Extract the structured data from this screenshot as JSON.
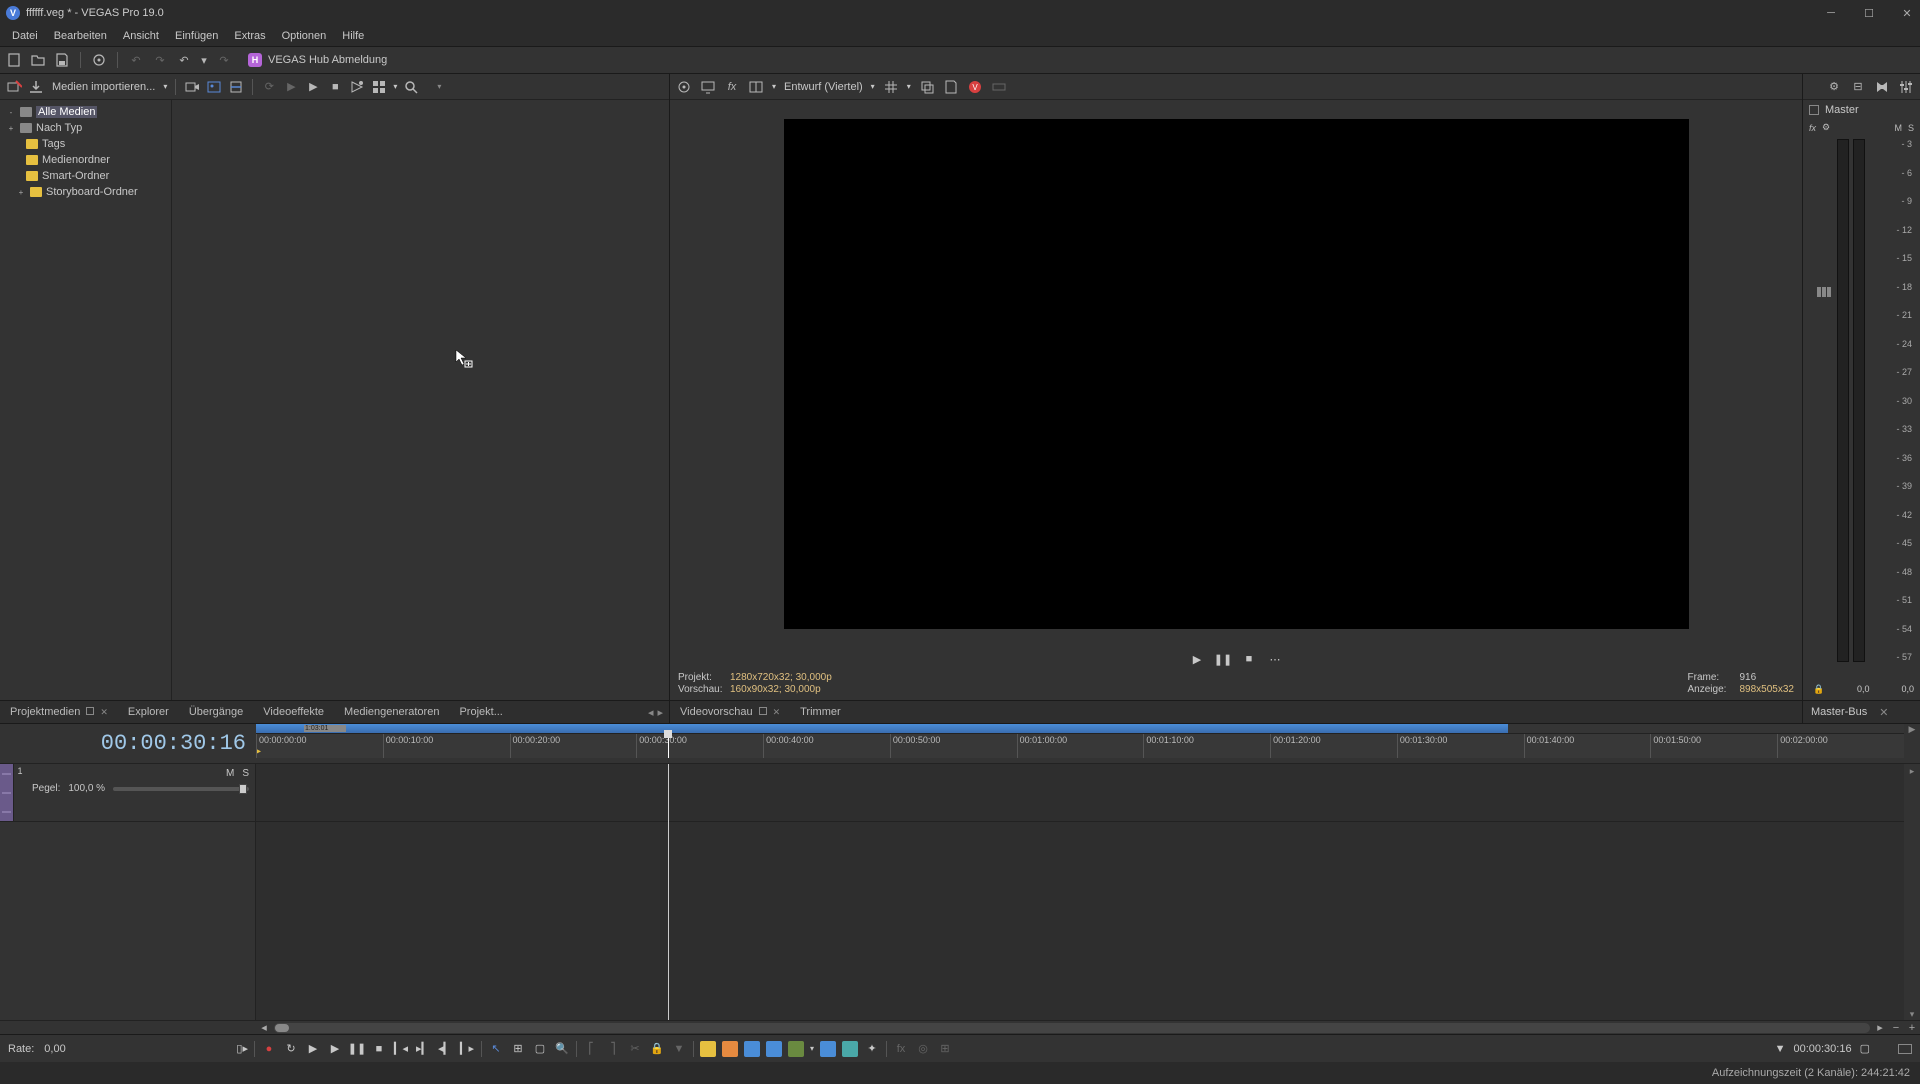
{
  "title": "ffffff.veg * - VEGAS Pro 19.0",
  "logo": "V",
  "menu": [
    "Datei",
    "Bearbeiten",
    "Ansicht",
    "Einfügen",
    "Extras",
    "Optionen",
    "Hilfe"
  ],
  "hub": {
    "icon": "H",
    "label": "VEGAS Hub Abmeldung"
  },
  "leftToolbar": {
    "import": "Medien importieren..."
  },
  "tree": [
    {
      "label": "Alle Medien",
      "sel": true,
      "exp": "-",
      "root": true,
      "indent": false
    },
    {
      "label": "Nach Typ",
      "exp": "+",
      "root": true,
      "indent": false
    },
    {
      "label": "Tags",
      "indent": true
    },
    {
      "label": "Medienordner",
      "indent": true
    },
    {
      "label": "Smart-Ordner",
      "indent": true
    },
    {
      "label": "Storyboard-Ordner",
      "exp": "+",
      "indent": true
    }
  ],
  "leftTabs": [
    "Projektmedien",
    "Explorer",
    "Übergänge",
    "Videoeffekte",
    "Mediengeneratoren",
    "Projekt..."
  ],
  "previewTabs": [
    "Videovorschau",
    "Trimmer"
  ],
  "previewToolbar": {
    "quality": "Entwurf (Viertel)"
  },
  "previewInfo": {
    "projektLabel": "Projekt:",
    "projektVal": "1280x720x32; 30,000p",
    "vorschauLabel": "Vorschau:",
    "vorschauVal": "160x90x32; 30,000p",
    "frameLabel": "Frame:",
    "frameVal": "916",
    "anzeigeLabel": "Anzeige:",
    "anzeigeVal": "898x505x32"
  },
  "master": {
    "title": "Master",
    "fxLabel": "fx",
    "m": "M",
    "s": "S",
    "tab": "Master-Bus",
    "left": "0,0",
    "right": "0,0"
  },
  "meterTicks": [
    "- 3",
    "- 6",
    "- 9",
    "- 12",
    "- 15",
    "- 18",
    "- 21",
    "- 24",
    "- 27",
    "- 30",
    "- 33",
    "- 36",
    "- 39",
    "- 42",
    "- 45",
    "- 48",
    "- 51",
    "- 54",
    "- 57"
  ],
  "timeline": {
    "time": "00:00:30:16",
    "miniLabel": "1:03:01",
    "ruler": [
      "00:00:00:00",
      "00:00:10:00",
      "00:00:20:00",
      "00:00:30:00",
      "00:00:40:00",
      "00:00:50:00",
      "00:01:00:00",
      "00:01:10:00",
      "00:01:20:00",
      "00:01:30:00",
      "00:01:40:00",
      "00:01:50:00",
      "00:02:00:00"
    ],
    "track": {
      "num": "1",
      "m": "M",
      "s": "S",
      "pegelLabel": "Pegel:",
      "pegelVal": "100,0 %"
    }
  },
  "bottom": {
    "rateLabel": "Rate:",
    "rateVal": "0,00",
    "tc": "00:00:30:16"
  },
  "status": "Aufzeichnungszeit (2 Kanäle): 244:21:42"
}
